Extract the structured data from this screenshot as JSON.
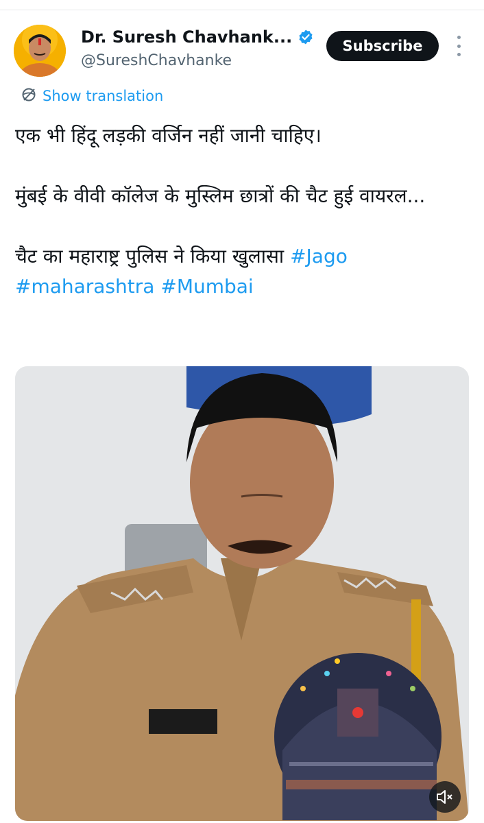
{
  "tweet": {
    "author": {
      "display_name": "Dr. Suresh Chavhank...",
      "handle": "@SureshChavhanke",
      "verified": true,
      "avatar_icon": "author-avatar"
    },
    "subscribe_label": "Subscribe",
    "more_icon": "more-vertical-icon",
    "translation": {
      "icon": "globe-icon",
      "label": "Show translation"
    },
    "text": {
      "line1": "एक भी हिंदू लड़की वर्जिन नहीं जानी चाहिए।",
      "line2": "मुंबई के वीवी कॉलेज के मुस्लिम छात्रों की चैट हुई वायरल...",
      "line3_prefix": "चैट का महाराष्ट्र पुलिस ने किया खुलासा ",
      "hashtags": [
        "#Jago",
        "#maharashtra",
        "#Mumbai"
      ]
    },
    "media": {
      "type": "video",
      "mute_icon": "muted-speaker-icon"
    }
  },
  "colors": {
    "accent": "#1d9bf0",
    "text_primary": "#0f1419",
    "text_secondary": "#536471",
    "button_bg": "#0f1419"
  }
}
